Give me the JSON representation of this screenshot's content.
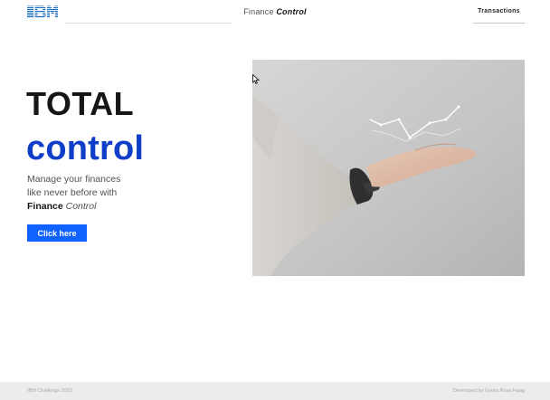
{
  "header": {
    "logo_text": "IBM",
    "brand_primary": "Finance",
    "brand_secondary": "Control",
    "nav_link": "Transactions"
  },
  "hero": {
    "title_line1": "TOTAL",
    "title_line2": "control",
    "desc_line1": "Manage your finances",
    "desc_line2": "like never before with",
    "desc_brand_bold": "Finance",
    "desc_brand_italic": "Control",
    "cta_label": "Click here"
  },
  "image": {
    "subject": "hand-with-chart-hologram",
    "alt": "Open palm presenting a floating line chart"
  },
  "footer": {
    "copyright": "IBM Challenge 2023",
    "credit": "Developed by Gyora Rosa Haag"
  },
  "colors": {
    "accent_blue": "#0f62fe",
    "title_blue": "#0f3ec8",
    "text_dark": "#161616",
    "footer_bg": "#ececec"
  }
}
